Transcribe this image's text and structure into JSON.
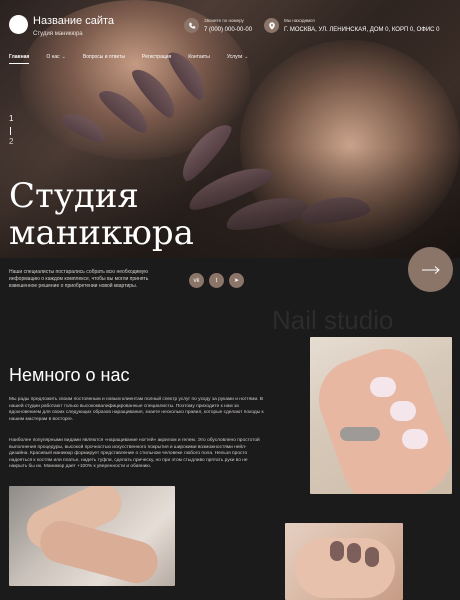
{
  "header": {
    "site_name": "Название сайта",
    "site_sub": "Студия маникюра",
    "phone_label": "Звоните по номеру",
    "phone_value": "7 (000) 000-00-00",
    "address_label": "Мы находимся",
    "address_value": "Г. МОСКВА, УЛ. ЛЕНИНСКАЯ, ДОМ 0, КОРП 0, ОФИС 0"
  },
  "nav": {
    "items": [
      {
        "label": "Главная",
        "caret": false
      },
      {
        "label": "О нас",
        "caret": true
      },
      {
        "label": "Вопросы и ответы",
        "caret": false
      },
      {
        "label": "Регистрация",
        "caret": false
      },
      {
        "label": "Контакты",
        "caret": false
      },
      {
        "label": "Услуги",
        "caret": true
      }
    ],
    "caret_glyph": "⌄"
  },
  "hero": {
    "slide_current": "1",
    "slide_total": "2",
    "title_line1": "Студия",
    "title_line2": "маникюра"
  },
  "intro": {
    "text": "Наши специалисты постарались собрать всю необходимую информацию о каждом комплексе, чтобы вы могли принять взвешенное решение о приобретении новой квартиры."
  },
  "social": {
    "icons": [
      "vk-icon",
      "twitter-icon",
      "telegram-icon"
    ],
    "glyphs": [
      "vk",
      "t",
      "➤"
    ]
  },
  "watermark": "Nail studio",
  "about": {
    "title": "Немного о нас",
    "p1": "Мы рады предложить своим постоянным и новым клиентам полный спектр услуг по уходу за руками и ногтями. В нашей студии работают только высококвалифицированные специалисты. Поэтому приходите к нам за вдохновением для своих следующих образов наращивания, знаете несколько правил, которые сделают походы к нашим мастерам в восторге.",
    "p2": "Наиболее популярными видами являются «наращивание ногтей» акрилом и гелем. Это обусловлено простотой выполнения процедуры, высокой прочностью искусственного покрытия и широкими возможностями нейл-дизайна. Красивый маникюр формирует представление о стильном человеке любого пола. Нельзя просто надеяться к костям или платье, надеть туфли, сделать прическу, но при этом стыдливо прятать руки во не накрыть бы их. Маникюр дает +100% к уверенности и обаянию."
  },
  "colors": {
    "accent": "#8b7468",
    "background": "#1b1b1b"
  }
}
